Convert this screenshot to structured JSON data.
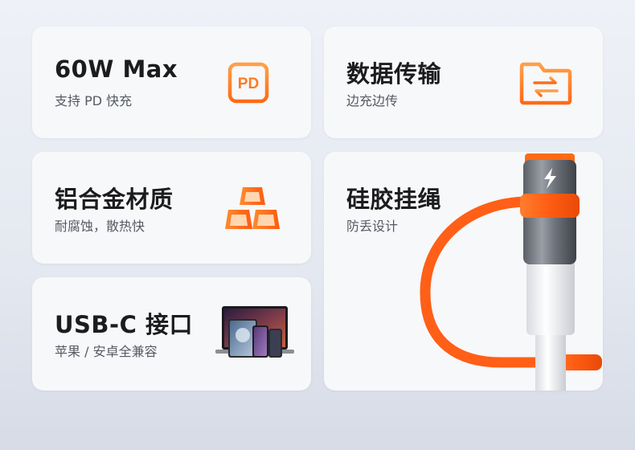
{
  "colors": {
    "accent": "#ff6a13",
    "accent_light": "#ff9a3c",
    "card_bg": "#f7f8fa",
    "page_bg": "#e4e8f0",
    "title": "#1c1c1e",
    "subtitle": "#555a62"
  },
  "cards": [
    {
      "title": "60W Max",
      "subtitle": "支持 PD 快充",
      "icon": "pd-chip-icon",
      "icon_text": "PD"
    },
    {
      "title": "数据传输",
      "subtitle": "边充边传",
      "icon": "folder-transfer-icon"
    },
    {
      "title": "铝合金材质",
      "subtitle": "耐腐蚀，散热快",
      "icon": "aluminum-blocks-icon"
    },
    {
      "title": "硅胶挂绳",
      "subtitle": "防丢设计",
      "icon": "cable-adapter-image"
    },
    {
      "title": "USB-C 接口",
      "subtitle": "苹果 / 安卓全兼容",
      "icon": "devices-image"
    }
  ]
}
